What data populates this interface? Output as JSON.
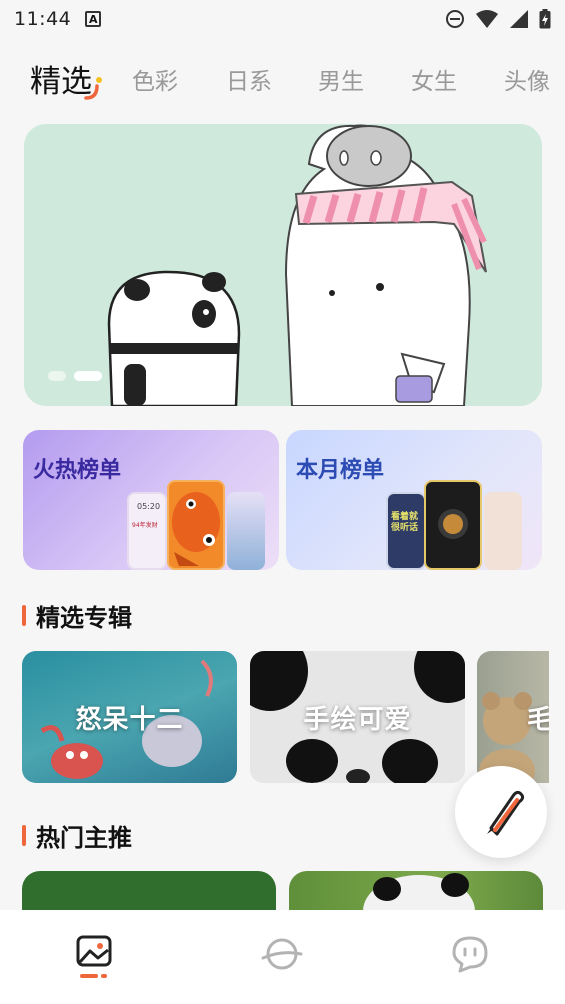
{
  "status_bar": {
    "time": "11:44",
    "notification_letter": "A",
    "icons": [
      "do-not-disturb-icon",
      "wifi-icon",
      "signal-icon",
      "battery-charging-icon"
    ]
  },
  "tabs": [
    {
      "label": "精选",
      "active": true
    },
    {
      "label": "色彩",
      "active": false
    },
    {
      "label": "日系",
      "active": false
    },
    {
      "label": "男生",
      "active": false
    },
    {
      "label": "女生",
      "active": false
    },
    {
      "label": "头像",
      "active": false
    }
  ],
  "banner": {
    "illustration": "panda-and-white-creature-with-pink-scarf",
    "background_color": "#cfe9dc",
    "pages": 2,
    "active_page": 2
  },
  "rankings": [
    {
      "title": "火热榜单",
      "phone_texts": [
        "05:20",
        "94年发财"
      ]
    },
    {
      "title": "本月榜单",
      "phone_texts": [
        "看着就很听话"
      ]
    }
  ],
  "sections": {
    "featured_albums": "精选专辑",
    "hot_picks": "热门主推"
  },
  "albums": [
    {
      "label": "怒呆十二",
      "theme": "underwater-cartoon"
    },
    {
      "label": "手绘可爱",
      "theme": "panda-face"
    },
    {
      "label": "毛",
      "theme": "teddy-bear"
    }
  ],
  "bottom_nav": [
    {
      "icon": "wallpaper-icon",
      "active": true
    },
    {
      "icon": "planet-icon",
      "active": false
    },
    {
      "icon": "chat-bubble-icon",
      "active": false
    }
  ],
  "colors": {
    "accent": "#f0663c",
    "tab_inactive": "#999999",
    "nav_active": "#222222",
    "nav_inactive": "#b3b3b3"
  }
}
